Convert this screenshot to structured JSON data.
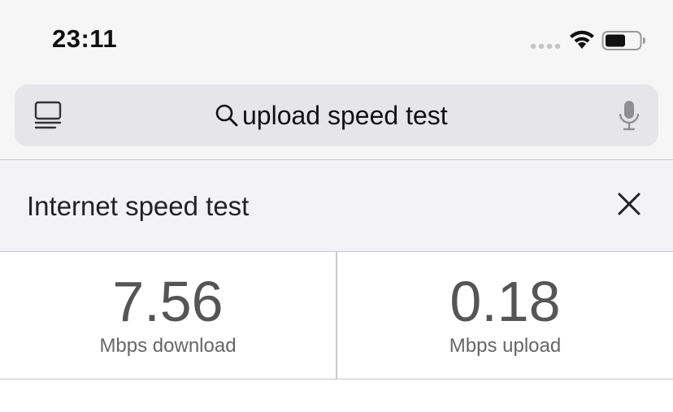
{
  "status_bar": {
    "time": "23:11",
    "icons": [
      "signal-dots-icon",
      "wifi-icon",
      "battery-icon"
    ]
  },
  "search": {
    "query": "upload speed test",
    "icons": [
      "tabs-icon",
      "search-icon",
      "microphone-icon"
    ]
  },
  "card": {
    "title": "Internet speed test",
    "close_icon": "close-icon"
  },
  "results": {
    "download": {
      "value": "7.56",
      "unit": "Mbps download"
    },
    "upload": {
      "value": "0.18",
      "unit": "Mbps upload"
    }
  },
  "colors": {
    "status_background": "#f6f6f6",
    "search_box": "#e5e5ea",
    "header_background": "#f2f2f7",
    "value_text": "#555555"
  }
}
